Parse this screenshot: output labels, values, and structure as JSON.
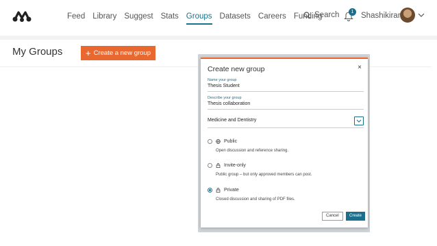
{
  "nav": {
    "items": [
      {
        "label": "Feed",
        "active": false
      },
      {
        "label": "Library",
        "active": false
      },
      {
        "label": "Suggest",
        "active": false
      },
      {
        "label": "Stats",
        "active": false
      },
      {
        "label": "Groups",
        "active": true
      },
      {
        "label": "Datasets",
        "active": false
      },
      {
        "label": "Careers",
        "active": false
      },
      {
        "label": "Funding",
        "active": false
      }
    ],
    "search_label": "Search",
    "notification_count": "1",
    "username": "Shashikiran",
    "accent_color": "#1a6f8c"
  },
  "page": {
    "title": "My Groups",
    "create_button_label": "Create a new group",
    "create_button_color": "#e8682f"
  },
  "modal": {
    "title": "Create new group",
    "close_symbol": "×",
    "name_label": "Name your group",
    "name_value": "Thesis Student",
    "description_label": "Describe your group",
    "description_value": "Thesis collaboration",
    "discipline_value": "Medicine and Dentistry",
    "options": [
      {
        "label": "Public",
        "description": "Open discussion and reference sharing.",
        "selected": false,
        "icon": "globe-icon"
      },
      {
        "label": "Invite-only",
        "description": "Public group – but only approved members can post.",
        "selected": false,
        "icon": "lock-icon"
      },
      {
        "label": "Private",
        "description": "Closed discussion and sharing of PDF files.",
        "selected": true,
        "icon": "lock-icon"
      }
    ],
    "cancel_label": "Cancel",
    "create_label": "Create"
  }
}
